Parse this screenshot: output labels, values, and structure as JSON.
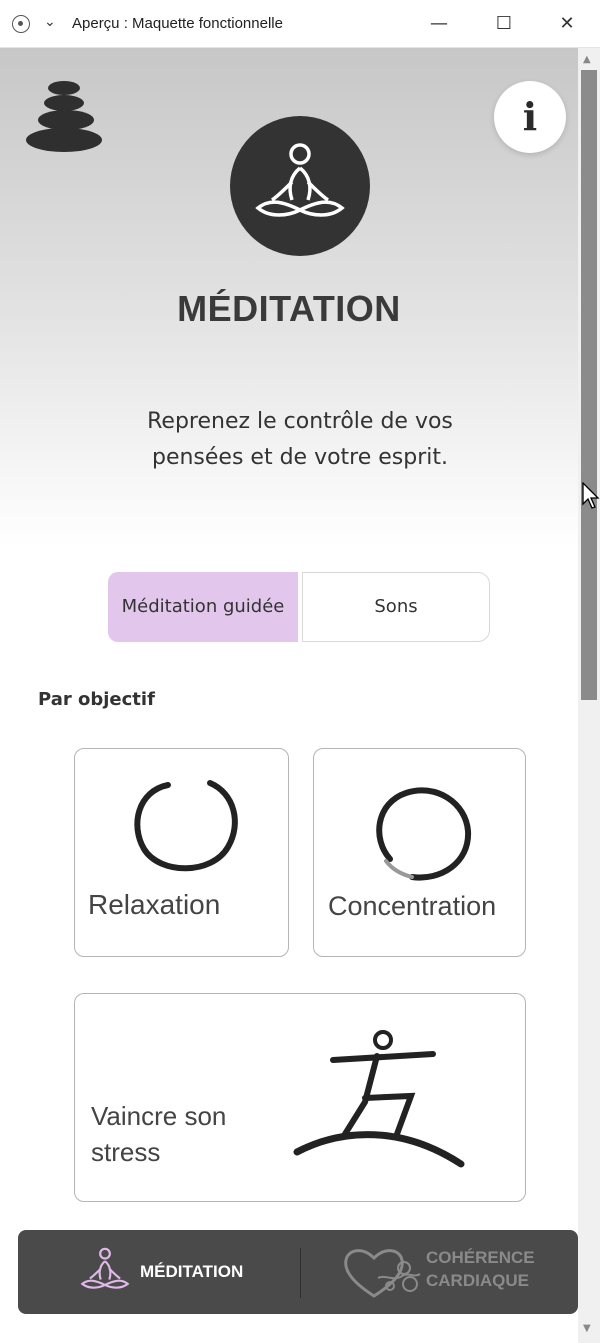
{
  "window": {
    "title": "Aperçu : Maquette fonctionnelle",
    "controls": {
      "minimize": "—",
      "maximize": "☐",
      "close": "✕"
    }
  },
  "header": {
    "logo_icon": "stacked-stones-icon",
    "info_label": "i",
    "hero_icon": "meditation-pose-icon"
  },
  "page": {
    "title": "MÉDITATION",
    "tagline": "Reprenez le contrôle de vos pensées et de votre esprit."
  },
  "segmented": {
    "options": [
      "Méditation guidée",
      "Sons"
    ],
    "selected_index": 0
  },
  "section": {
    "label": "Par objectif"
  },
  "cards": [
    {
      "label": "Relaxation",
      "icon": "enso-circle-icon"
    },
    {
      "label": "Concentration",
      "icon": "enso-ring-icon"
    },
    {
      "label": "Vaincre son stress",
      "icon": "calligraphy-figure-icon"
    }
  ],
  "tabbar": {
    "tabs": [
      {
        "label": "MÉDITATION",
        "icon": "meditation-pose-icon",
        "active": true
      },
      {
        "label": "COHÉRENCE CARDIAQUE",
        "label_line1": "COHÉRENCE",
        "label_line2": "CARDIAQUE",
        "icon": "heart-waves-icon",
        "active": false
      }
    ]
  },
  "colors": {
    "accent_selected": "#e3c6ec",
    "dark": "#333333",
    "tabbar_bg": "#4a4a4a"
  }
}
